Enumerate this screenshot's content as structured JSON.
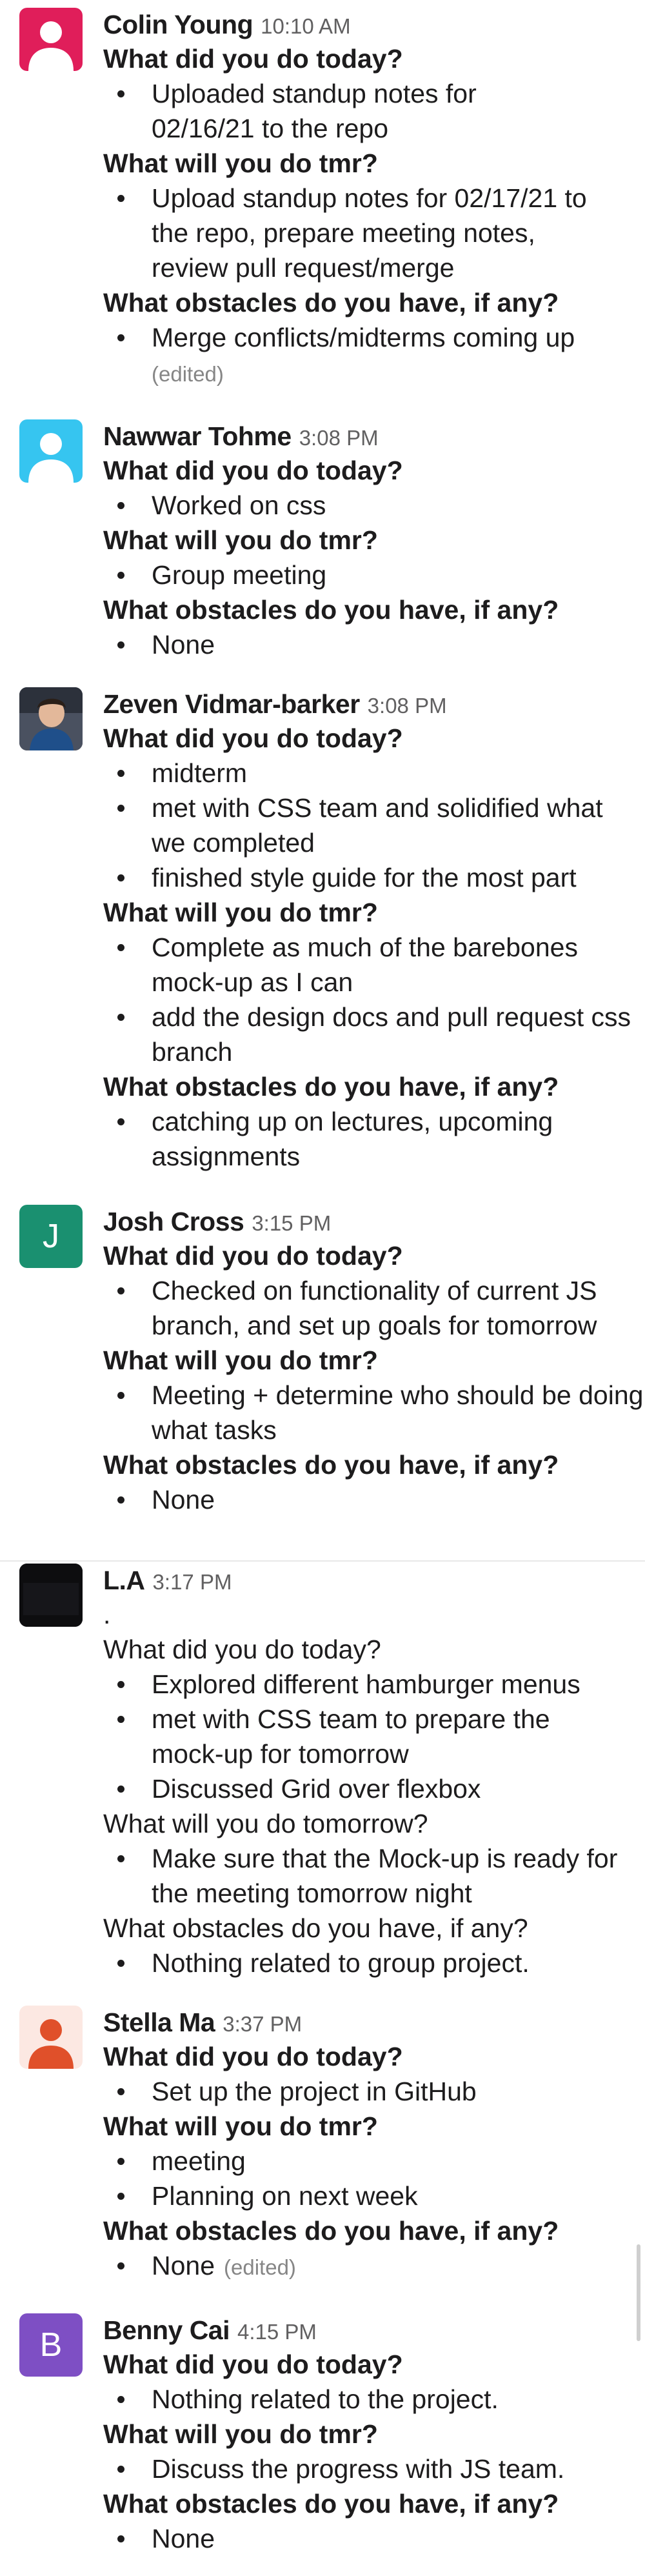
{
  "messages": [
    {
      "author": "Colin Young",
      "time": "10:10 AM",
      "avatar": {
        "kind": "person",
        "bg": "#e01e5a",
        "fg": "#ffffff"
      },
      "sections": [
        {
          "question": "What did you do today?",
          "items": [
            "Uploaded standup notes for 02/16/21 to the repo"
          ]
        },
        {
          "question": "What will you do tmr?",
          "items": [
            "Upload standup notes for 02/17/21 to the repo, prepare meeting notes, review pull request/merge"
          ]
        },
        {
          "question": "What obstacles do you have, if any?",
          "items": [
            "Merge conflicts/midterms coming up"
          ]
        }
      ],
      "edited": "(edited)"
    },
    {
      "author": "Nawwar Tohme",
      "time": "3:08 PM",
      "avatar": {
        "kind": "person",
        "bg": "#36c5f0",
        "fg": "#ffffff"
      },
      "sections": [
        {
          "question": "What did you do today?",
          "items": [
            "Worked on css"
          ]
        },
        {
          "question": "What will you do tmr?",
          "items": [
            "Group meeting"
          ]
        },
        {
          "question": "What obstacles do you have, if any?",
          "items": [
            "None"
          ]
        }
      ]
    },
    {
      "author": "Zeven Vidmar-barker",
      "time": "3:08 PM",
      "avatar": {
        "kind": "photo",
        "bg": "#3a3f4a"
      },
      "sections": [
        {
          "question": "What did you do today?",
          "items": [
            "midterm",
            "met with CSS team and solidified what we completed",
            "finished style guide for the most part"
          ]
        },
        {
          "question": "What will you do tmr?",
          "items": [
            "Complete as much of the barebones mock-up as I can",
            "add the design docs and pull request css branch"
          ]
        },
        {
          "question": "What obstacles do you have, if any?",
          "items": [
            "catching up on lectures, upcoming assignments"
          ]
        }
      ]
    },
    {
      "author": "Josh Cross",
      "time": "3:15 PM",
      "avatar": {
        "kind": "letter",
        "letter": "J",
        "bg": "#1a9070"
      },
      "sections": [
        {
          "question": "What did you do today?",
          "items": [
            "Checked on functionality of current JS branch, and set up goals for tomorrow"
          ]
        },
        {
          "question": "What will you do tmr?",
          "items": [
            "Meeting + determine who should be doing what tasks"
          ]
        },
        {
          "question": "What obstacles do you have, if any?",
          "items": [
            "None"
          ]
        }
      ]
    },
    {
      "author": "L.A",
      "time": "3:17 PM",
      "avatar": {
        "kind": "dark",
        "bg": "#0d0d0f"
      },
      "prefix": ".",
      "sections": [
        {
          "question": "What did you do today?",
          "items": [
            "Explored different hamburger menus",
            "met with CSS team to prepare the mock-up for tomorrow",
            "Discussed Grid over flexbox"
          ]
        },
        {
          "question": "What will you do tomorrow?",
          "items": [
            "Make sure that the Mock-up is ready for the meeting tomorrow night"
          ]
        },
        {
          "question": "What obstacles do you have, if any?",
          "items": [
            "Nothing related to group project."
          ]
        }
      ]
    },
    {
      "author": "Stella Ma",
      "time": "3:37 PM",
      "avatar": {
        "kind": "person",
        "bg": "#fce8e2",
        "fg": "#e0502a"
      },
      "sections": [
        {
          "question": "What did you do today?",
          "items": [
            "Set up the project in GitHub"
          ]
        },
        {
          "question": "What will you do tmr?",
          "items": [
            "meeting",
            "Planning on next week"
          ]
        },
        {
          "question": "What obstacles do you have, if any?",
          "items": [
            "None"
          ]
        }
      ],
      "edited_inline": "(edited)"
    },
    {
      "author": "Benny Cai",
      "time": "4:15 PM",
      "avatar": {
        "kind": "letter",
        "letter": "B",
        "bg": "#7e4fc4"
      },
      "sections": [
        {
          "question": "What did you do today?",
          "items": [
            "Nothing related to the project."
          ]
        },
        {
          "question": "What will you do tmr?",
          "items": [
            "Discuss the progress with JS team."
          ]
        },
        {
          "question": "What obstacles do you have, if any?",
          "items": [
            "None"
          ]
        }
      ]
    }
  ]
}
